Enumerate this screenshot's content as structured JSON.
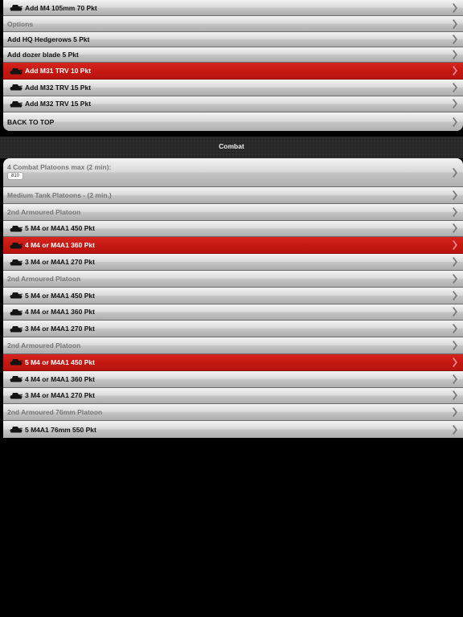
{
  "top_list": {
    "items": [
      {
        "label": "Add M4 105mm 70 Pkt",
        "icon": "tank-icon",
        "kind": "tank",
        "selected": false
      },
      {
        "label": "Options",
        "kind": "head",
        "selected": false
      },
      {
        "label": "Add HQ Hedgerows 5 Pkt",
        "kind": "plain",
        "selected": false
      },
      {
        "label": "Add dozer blade 5 Pkt",
        "kind": "plain",
        "selected": false
      },
      {
        "label": "Add M31 TRV 10 Pkt",
        "icon": "tank-icon",
        "kind": "tank",
        "selected": true
      },
      {
        "label": "Add M32 TRV 15 Pkt",
        "icon": "tank-icon",
        "kind": "tank",
        "selected": false
      },
      {
        "label": "Add M32 TRV 15 Pkt",
        "icon": "tank-icon",
        "kind": "tank",
        "selected": false
      },
      {
        "label": "BACK TO TOP",
        "kind": "plain",
        "selected": false
      }
    ]
  },
  "combat_section": {
    "title": "Combat",
    "header": {
      "label": "4 Combat Platoons max (2 min):",
      "badge": "810"
    },
    "items": [
      {
        "label": "Medium Tank Platoons - (2 min.)",
        "kind": "head",
        "selected": false
      },
      {
        "label": "2nd Armoured Platoon",
        "kind": "head",
        "selected": false
      },
      {
        "label": "5 M4 or M4A1 450 Pkt",
        "icon": "tank-icon",
        "kind": "tank",
        "selected": false
      },
      {
        "label": "4 M4 or M4A1 360 Pkt",
        "icon": "tank-icon",
        "kind": "tank",
        "selected": true
      },
      {
        "label": "3 M4 or M4A1 270 Pkt",
        "icon": "tank-icon",
        "kind": "tank",
        "selected": false
      },
      {
        "label": "2nd Armoured Platoon",
        "kind": "head",
        "selected": false
      },
      {
        "label": "5 M4 or M4A1 450 Pkt",
        "icon": "tank-icon",
        "kind": "tank",
        "selected": false
      },
      {
        "label": "4 M4 or M4A1 360 Pkt",
        "icon": "tank-icon",
        "kind": "tank",
        "selected": false
      },
      {
        "label": "3 M4 or M4A1 270 Pkt",
        "icon": "tank-icon",
        "kind": "tank",
        "selected": false
      },
      {
        "label": "2nd Armoured Platoon",
        "kind": "head",
        "selected": false
      },
      {
        "label": "5 M4 or M4A1 450 Pkt",
        "icon": "tank-icon",
        "kind": "tank",
        "selected": true
      },
      {
        "label": "4 M4 or M4A1 360 Pkt",
        "icon": "tank-icon",
        "kind": "tank",
        "selected": false
      },
      {
        "label": "3 M4 or M4A1 270 Pkt",
        "icon": "tank-icon",
        "kind": "tank",
        "selected": false
      },
      {
        "label": "2nd Armoured 76mm Platoon",
        "kind": "head",
        "selected": false
      },
      {
        "label": "5 M4A1 76mm 550 Pkt",
        "icon": "tank-icon",
        "kind": "tank",
        "selected": false
      }
    ]
  },
  "colors": {
    "selected_row": "#c41711",
    "background": "#000000",
    "row_light": "#e6e6e6"
  }
}
